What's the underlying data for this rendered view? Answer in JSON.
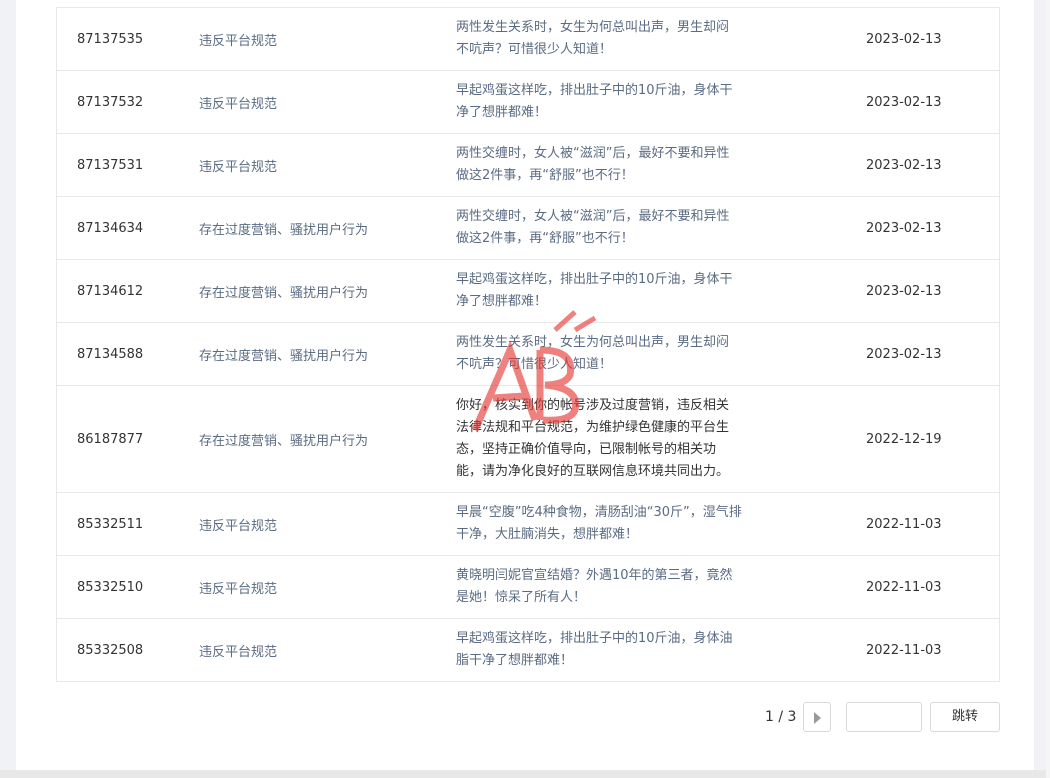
{
  "rows": [
    {
      "id": "87137535",
      "reason": "违反平台规范",
      "title_line1": "两性发生关系时，女生为何总叫出声，男生却闷",
      "title_line2": "不吭声？可惜很少人知道！",
      "date": "2023-02-13"
    },
    {
      "id": "87137532",
      "reason": "违反平台规范",
      "title_line1": "早起鸡蛋这样吃，排出肚子中的10斤油，身体干",
      "title_line2": "净了想胖都难！",
      "date": "2023-02-13"
    },
    {
      "id": "87137531",
      "reason": "违反平台规范",
      "title_line1": "两性交缠时，女人被“滋润”后，最好不要和异性",
      "title_line2": "做这2件事，再“舒服”也不行！",
      "date": "2023-02-13"
    },
    {
      "id": "87134634",
      "reason": "存在过度营销、骚扰用户行为",
      "title_line1": "两性交缠时，女人被“滋润”后，最好不要和异性",
      "title_line2": "做这2件事，再“舒服”也不行！",
      "date": "2023-02-13"
    },
    {
      "id": "87134612",
      "reason": "存在过度营销、骚扰用户行为",
      "title_line1": "早起鸡蛋这样吃，排出肚子中的10斤油，身体干",
      "title_line2": "净了想胖都难！",
      "date": "2023-02-13"
    },
    {
      "id": "87134588",
      "reason": "存在过度营销、骚扰用户行为",
      "title_line1": "两性发生关系时，女生为何总叫出声，男生却闷",
      "title_line2": "不吭声？可惜很少人知道！",
      "date": "2023-02-13"
    },
    {
      "id": "86187877",
      "reason": "存在过度营销、骚扰用户行为",
      "title_line1": "你好，核实到你的帐号涉及过度营销，违反相关",
      "title_line2": "法律法规和平台规范，为维护绿色健康的平台生",
      "title_line3": "态，坚持正确价值导向，已限制帐号的相关功",
      "title_line4": "能，请为净化良好的互联网信息环境共同出力。",
      "date": "2022-12-19"
    },
    {
      "id": "85332511",
      "reason": "违反平台规范",
      "title_line1": "早晨“空腹”吃4种食物，清肠刮油“30斤”，湿气排",
      "title_line2": "干净，大肚腩消失，想胖都难！",
      "date": "2022-11-03"
    },
    {
      "id": "85332510",
      "reason": "违反平台规范",
      "title_line1": "黄晓明闫妮官宣结婚？外遇10年的第三者，竟然",
      "title_line2": "是她！惊呆了所有人！",
      "date": "2022-11-03"
    },
    {
      "id": "85332508",
      "reason": "违反平台规范",
      "title_line1": "早起鸡蛋这样吃，排出肚子中的10斤油，身体油",
      "title_line2": "脂干净了想胖都难！",
      "date": "2022-11-03"
    }
  ],
  "pagination": {
    "page_info": "1 / 3",
    "jump_label": "跳转",
    "jump_placeholder": ""
  },
  "watermark": {
    "text": "AB 测试"
  },
  "colors": {
    "accent": "#e53935",
    "reason_text": "#5b6b83"
  }
}
